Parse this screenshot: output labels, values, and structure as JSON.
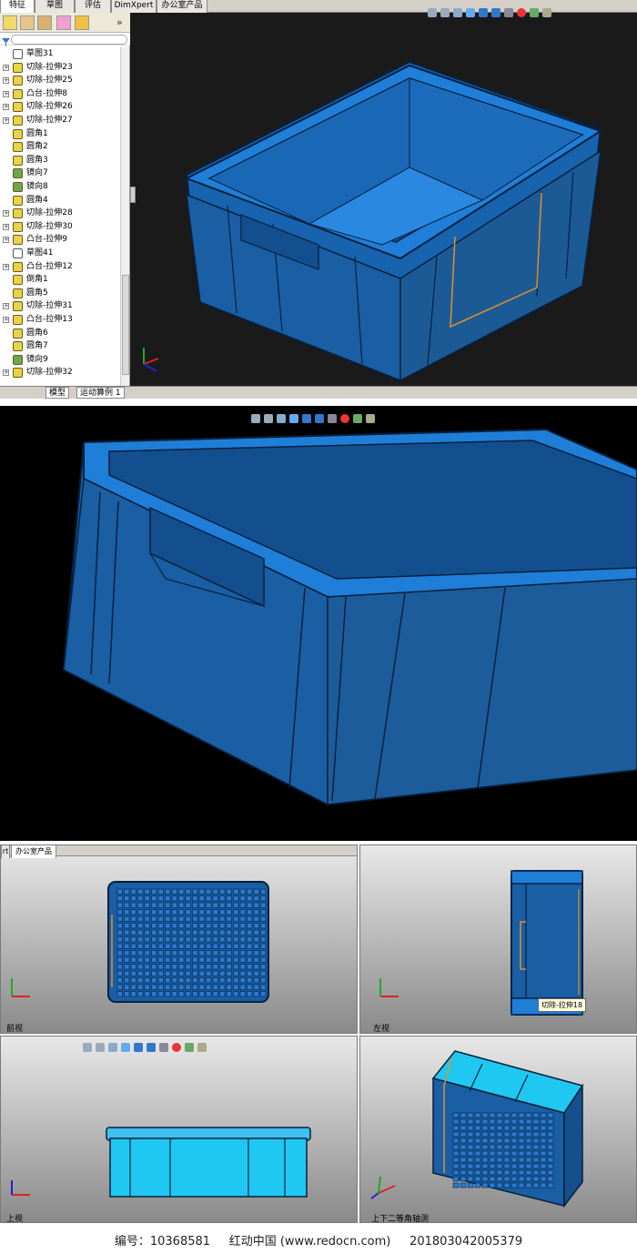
{
  "top_tabs": [
    "特征",
    "草图",
    "评估",
    "DimXpert",
    "办公室产品"
  ],
  "tree_items": [
    {
      "label": "草图31",
      "kind": "sketch",
      "expandable": false
    },
    {
      "label": "切除-拉伸23",
      "kind": "cut",
      "expandable": true
    },
    {
      "label": "切除-拉伸25",
      "kind": "cut",
      "expandable": true
    },
    {
      "label": "凸台-拉伸8",
      "kind": "boss",
      "expandable": true
    },
    {
      "label": "切除-拉伸26",
      "kind": "cut",
      "expandable": true
    },
    {
      "label": "切除-拉伸27",
      "kind": "cut",
      "expandable": true
    },
    {
      "label": "圆角1",
      "kind": "fillet",
      "expandable": false
    },
    {
      "label": "圆角2",
      "kind": "fillet",
      "expandable": false
    },
    {
      "label": "圆角3",
      "kind": "fillet",
      "expandable": false
    },
    {
      "label": "镜向7",
      "kind": "mirror",
      "expandable": false
    },
    {
      "label": "镜向8",
      "kind": "mirror",
      "expandable": false
    },
    {
      "label": "圆角4",
      "kind": "fillet",
      "expandable": false
    },
    {
      "label": "切除-拉伸28",
      "kind": "cut",
      "expandable": true
    },
    {
      "label": "切除-拉伸30",
      "kind": "cut",
      "expandable": true
    },
    {
      "label": "凸台-拉伸9",
      "kind": "boss",
      "expandable": true
    },
    {
      "label": "草图41",
      "kind": "sketch",
      "expandable": false
    },
    {
      "label": "凸台-拉伸12",
      "kind": "boss",
      "expandable": true
    },
    {
      "label": "倒角1",
      "kind": "fillet",
      "expandable": false
    },
    {
      "label": "圆角5",
      "kind": "fillet",
      "expandable": false
    },
    {
      "label": "切除-拉伸31",
      "kind": "cut",
      "expandable": true
    },
    {
      "label": "凸台-拉伸13",
      "kind": "boss",
      "expandable": true
    },
    {
      "label": "圆角6",
      "kind": "fillet",
      "expandable": false
    },
    {
      "label": "圆角7",
      "kind": "fillet",
      "expandable": false
    },
    {
      "label": "镜向9",
      "kind": "mirror",
      "expandable": false
    },
    {
      "label": "切除-拉伸32",
      "kind": "cut",
      "expandable": true
    }
  ],
  "bottom_tabs": [
    "模型",
    "运动算例 1"
  ],
  "viewport_tabs_partial": [
    "rt",
    "办公室产品"
  ],
  "views": {
    "front": "前视",
    "left": "左视",
    "top": "上视",
    "iso": "上下二等角轴测"
  },
  "tooltip": "切除-拉伸18",
  "expand_glyph": "»",
  "footer": {
    "id_text": "编号：10368581",
    "site_text": "红动中国 (www.redocn.com)",
    "stamp_text": "20180304200537​9"
  },
  "colors": {
    "model_blue": "#1e6fc0",
    "model_edge": "#0a2a55",
    "model_cyan": "#1ec8f0",
    "highlight_orange": "#e0902a",
    "panel_dark": "#1a1a1a"
  }
}
